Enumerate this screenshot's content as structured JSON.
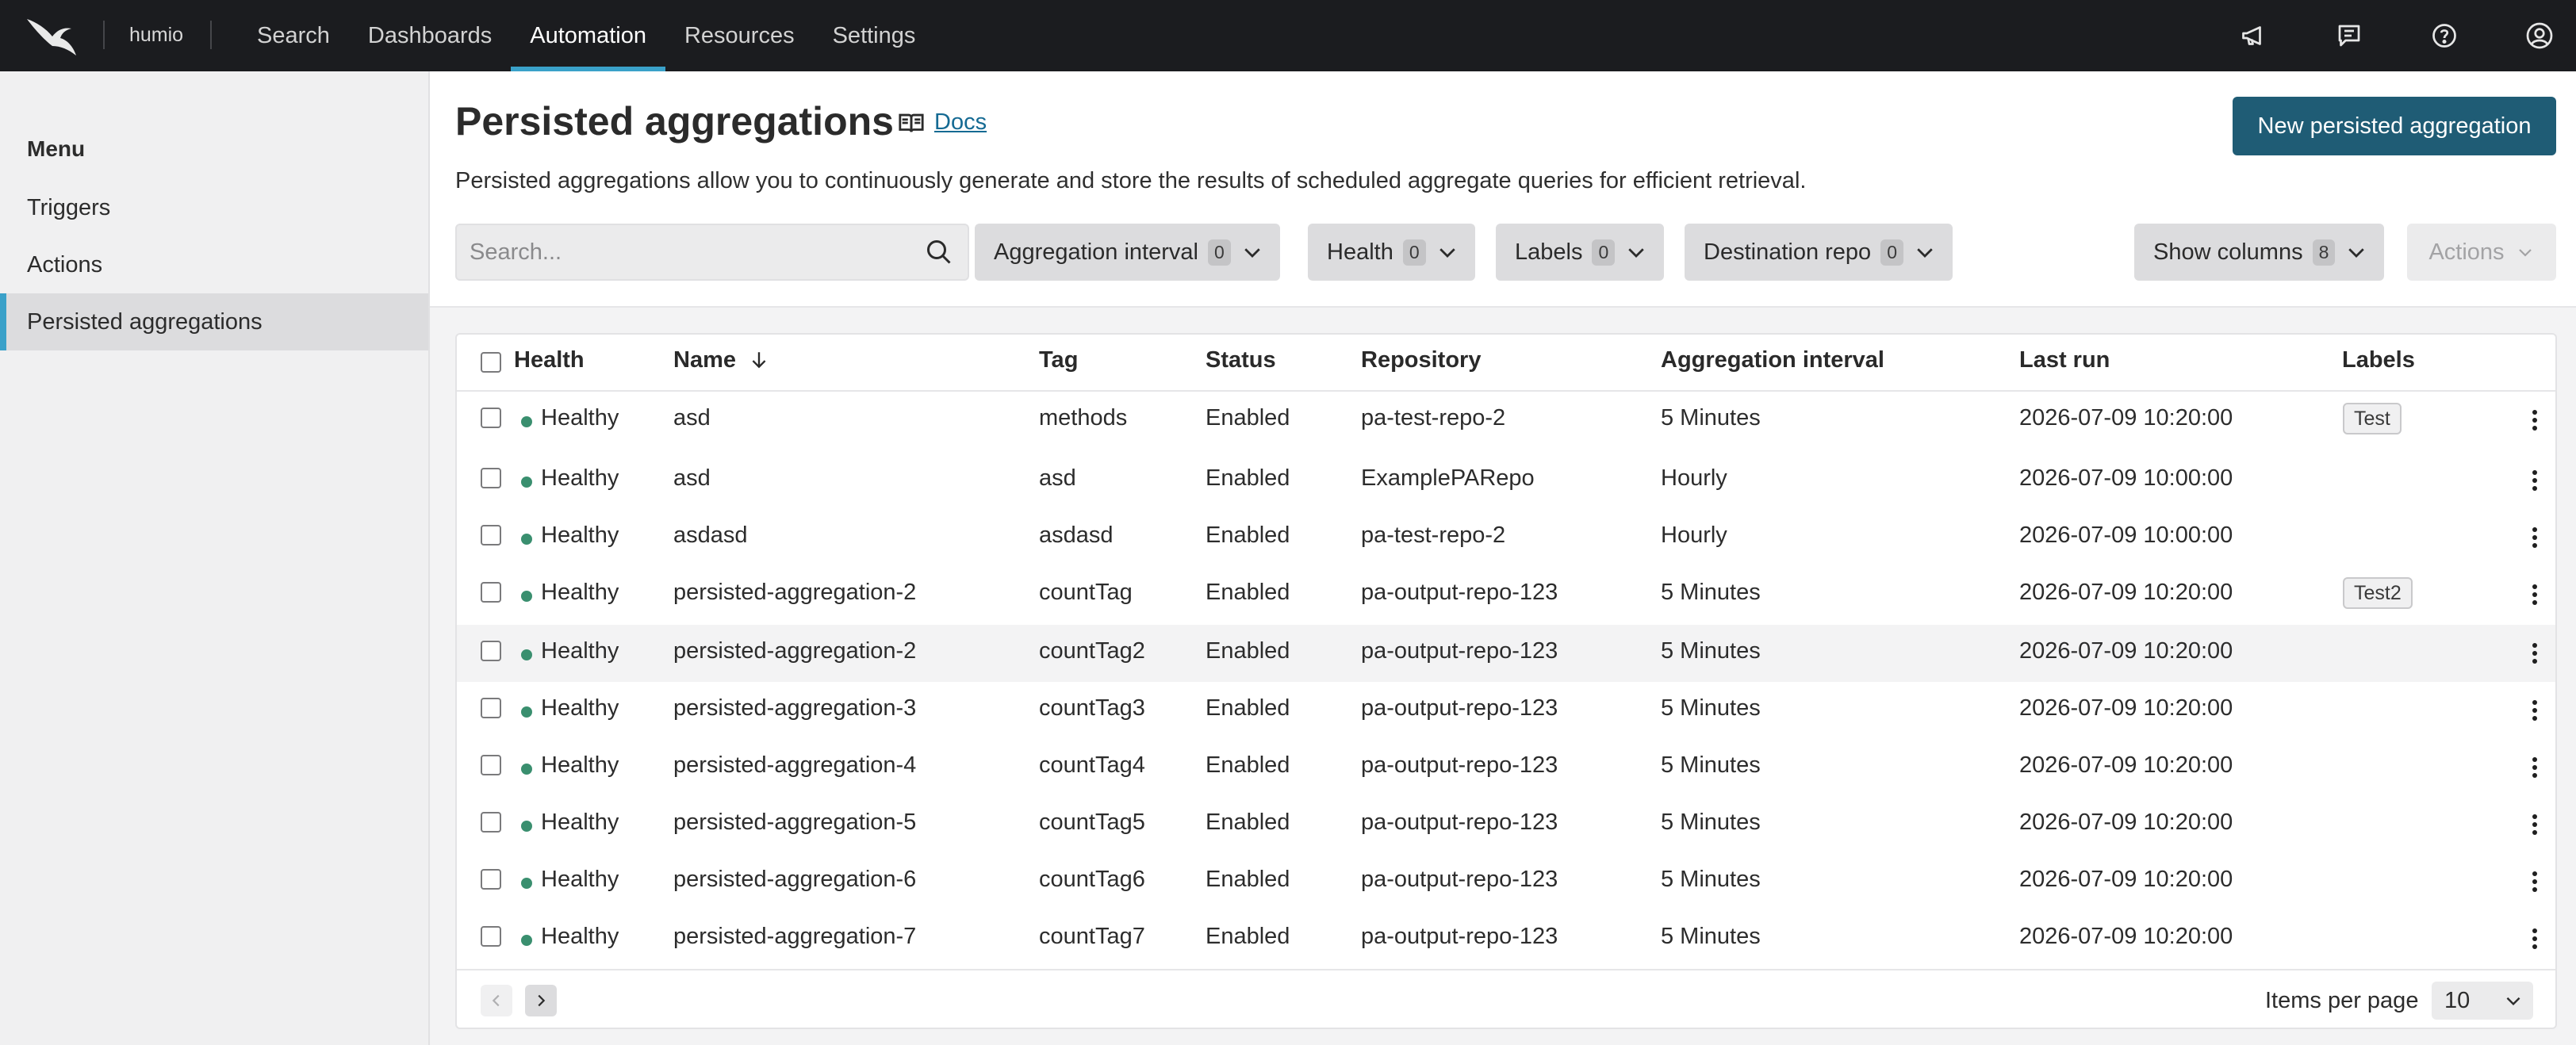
{
  "topnav": {
    "org": "humio",
    "links": [
      "Search",
      "Dashboards",
      "Automation",
      "Resources",
      "Settings"
    ],
    "active_link": "Automation",
    "icons": [
      "announcement-icon",
      "feedback-icon",
      "help-icon",
      "user-icon"
    ]
  },
  "sidebar": {
    "menu_title": "Menu",
    "items": [
      "Triggers",
      "Actions",
      "Persisted aggregations"
    ],
    "active_item": "Persisted aggregations"
  },
  "header": {
    "title": "Persisted aggregations",
    "docs_label": "Docs",
    "new_button": "New persisted aggregation",
    "description": "Persisted aggregations allow you to continuously generate and store the results of scheduled aggregate queries for efficient retrieval."
  },
  "toolbar": {
    "search_placeholder": "Search...",
    "filters": [
      {
        "label": "Aggregation interval",
        "count": "0"
      },
      {
        "label": "Health",
        "count": "0"
      },
      {
        "label": "Labels",
        "count": "0"
      },
      {
        "label": "Destination repo",
        "count": "0"
      }
    ],
    "show_columns": {
      "label": "Show columns",
      "count": "8"
    },
    "actions_label": "Actions"
  },
  "table": {
    "columns": [
      "Health",
      "Name",
      "Tag",
      "Status",
      "Repository",
      "Aggregation interval",
      "Last run",
      "Labels"
    ],
    "sort_column": "Name",
    "rows": [
      {
        "health": "Healthy",
        "name": "asd",
        "tag": "methods",
        "status": "Enabled",
        "repository": "pa-test-repo-2",
        "interval": "5 Minutes",
        "last_run": "2026-07-09 10:20:00",
        "label": "Test"
      },
      {
        "health": "Healthy",
        "name": "asd",
        "tag": "asd",
        "status": "Enabled",
        "repository": "ExamplePARepo",
        "interval": "Hourly",
        "last_run": "2026-07-09 10:00:00",
        "label": ""
      },
      {
        "health": "Healthy",
        "name": "asdasd",
        "tag": "asdasd",
        "status": "Enabled",
        "repository": "pa-test-repo-2",
        "interval": "Hourly",
        "last_run": "2026-07-09 10:00:00",
        "label": ""
      },
      {
        "health": "Healthy",
        "name": "persisted-aggregation-2",
        "tag": "countTag",
        "status": "Enabled",
        "repository": "pa-output-repo-123",
        "interval": "5 Minutes",
        "last_run": "2026-07-09 10:20:00",
        "label": "Test2"
      },
      {
        "health": "Healthy",
        "name": "persisted-aggregation-2",
        "tag": "countTag2",
        "status": "Enabled",
        "repository": "pa-output-repo-123",
        "interval": "5 Minutes",
        "last_run": "2026-07-09 10:20:00",
        "label": ""
      },
      {
        "health": "Healthy",
        "name": "persisted-aggregation-3",
        "tag": "countTag3",
        "status": "Enabled",
        "repository": "pa-output-repo-123",
        "interval": "5 Minutes",
        "last_run": "2026-07-09 10:20:00",
        "label": ""
      },
      {
        "health": "Healthy",
        "name": "persisted-aggregation-4",
        "tag": "countTag4",
        "status": "Enabled",
        "repository": "pa-output-repo-123",
        "interval": "5 Minutes",
        "last_run": "2026-07-09 10:20:00",
        "label": ""
      },
      {
        "health": "Healthy",
        "name": "persisted-aggregation-5",
        "tag": "countTag5",
        "status": "Enabled",
        "repository": "pa-output-repo-123",
        "interval": "5 Minutes",
        "last_run": "2026-07-09 10:20:00",
        "label": ""
      },
      {
        "health": "Healthy",
        "name": "persisted-aggregation-6",
        "tag": "countTag6",
        "status": "Enabled",
        "repository": "pa-output-repo-123",
        "interval": "5 Minutes",
        "last_run": "2026-07-09 10:20:00",
        "label": ""
      },
      {
        "health": "Healthy",
        "name": "persisted-aggregation-7",
        "tag": "countTag7",
        "status": "Enabled",
        "repository": "pa-output-repo-123",
        "interval": "5 Minutes",
        "last_run": "2026-07-09 10:20:00",
        "label": ""
      }
    ]
  },
  "footer": {
    "items_per_page_label": "Items per page",
    "items_per_page_value": "10"
  },
  "colors": {
    "nav_bg": "#1b1c1f",
    "accent": "#3aa1c9",
    "primary_button": "#1f5c75",
    "healthy_dot": "#3a8f6f",
    "link": "#156a93"
  }
}
